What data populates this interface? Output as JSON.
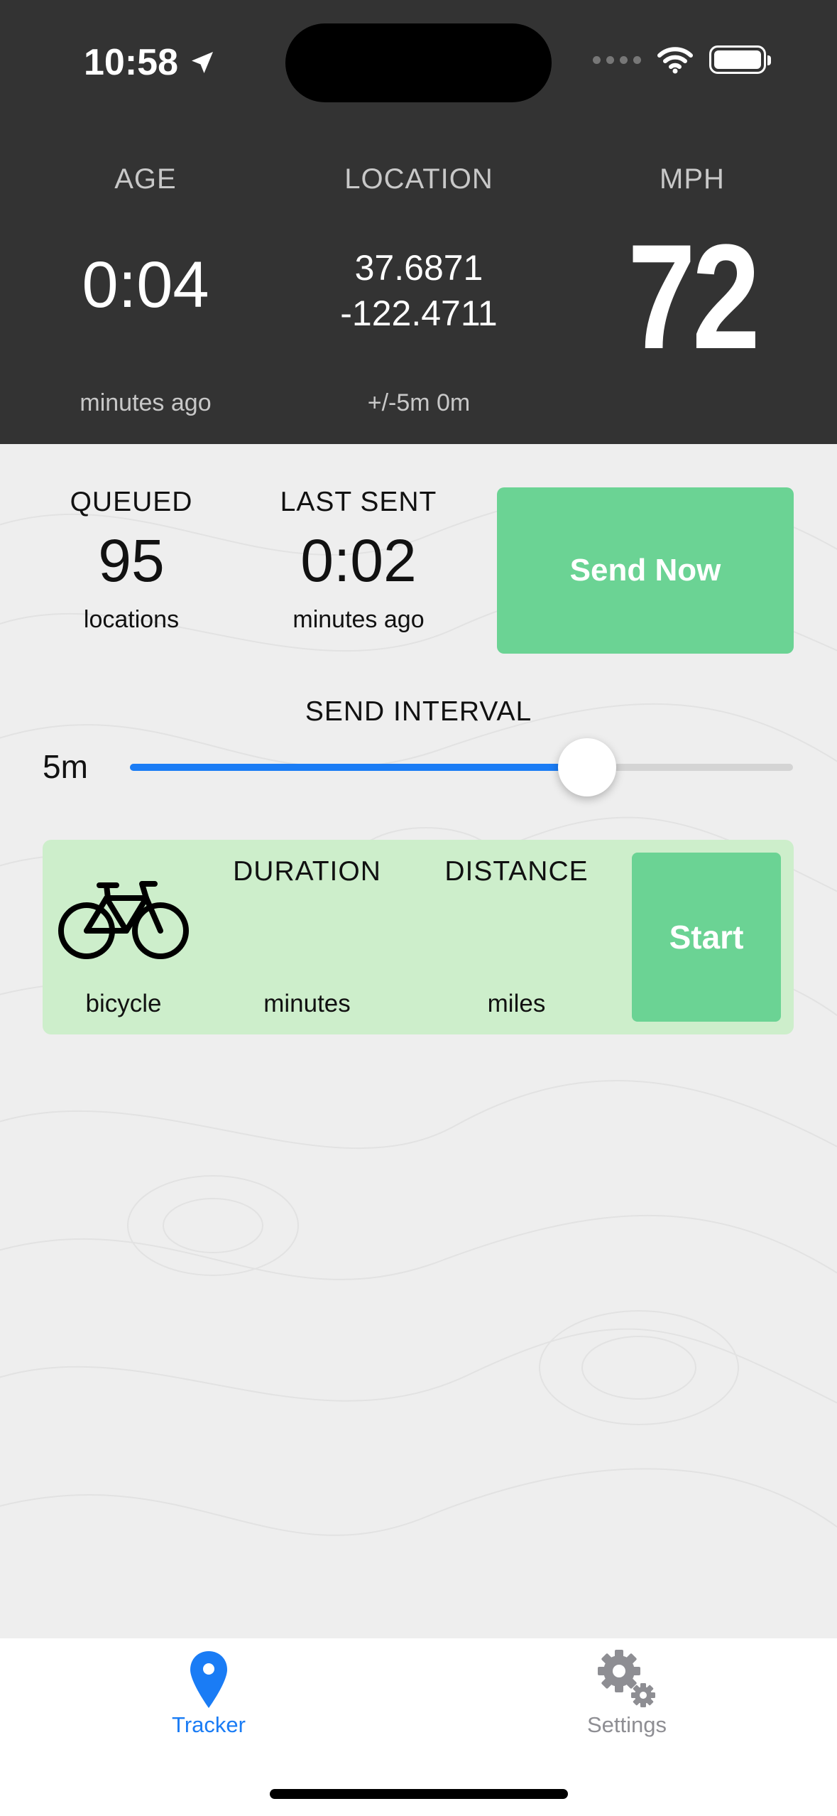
{
  "status_bar": {
    "time": "10:58"
  },
  "header": {
    "age": {
      "label": "AGE",
      "value": "0:04",
      "sub": "minutes ago"
    },
    "location": {
      "label": "LOCATION",
      "lat": "37.6871",
      "lon": "-122.4711",
      "sub": "+/-5m 0m"
    },
    "speed": {
      "label": "MPH",
      "value": "72"
    }
  },
  "queue": {
    "queued": {
      "label": "QUEUED",
      "value": "95",
      "sub": "locations"
    },
    "last_sent": {
      "label": "LAST SENT",
      "value": "0:02",
      "sub": "minutes ago"
    },
    "send_now_label": "Send Now"
  },
  "send_interval": {
    "label": "SEND INTERVAL",
    "value": "5m",
    "slider_fraction": 0.69
  },
  "trip": {
    "activity": "bicycle",
    "duration_label": "DURATION",
    "duration_unit": "minutes",
    "distance_label": "DISTANCE",
    "distance_unit": "miles",
    "start_label": "Start"
  },
  "tabbar": {
    "items": [
      {
        "label": "Tracker",
        "icon": "map-pin-icon",
        "active": true
      },
      {
        "label": "Settings",
        "icon": "gears-icon",
        "active": false
      }
    ]
  },
  "colors": {
    "accent_blue": "#1a7cf5",
    "button_green": "#6bd394",
    "card_green": "#cdeecb",
    "header_bg": "#333333"
  }
}
